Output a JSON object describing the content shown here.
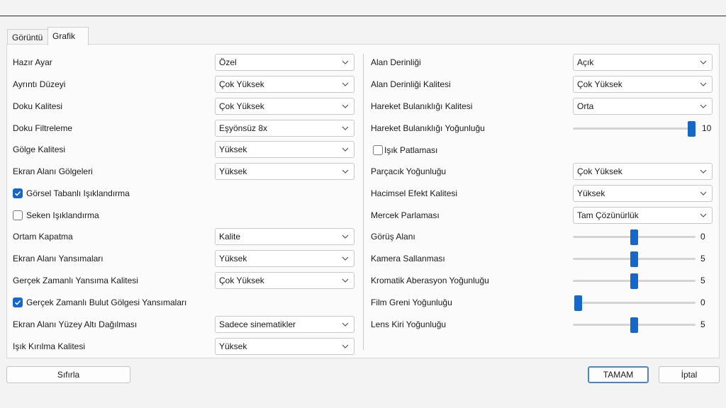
{
  "tabs": {
    "display": "Görüntü",
    "graphics": "Grafik"
  },
  "left": {
    "preset": {
      "label": "Hazır Ayar",
      "value": "Özel"
    },
    "detail": {
      "label": "Ayrıntı Düzeyi",
      "value": "Çok Yüksek"
    },
    "texture": {
      "label": "Doku Kalitesi",
      "value": "Çok Yüksek"
    },
    "filter": {
      "label": "Doku Filtreleme",
      "value": "Eşyönsüz 8x"
    },
    "shadow": {
      "label": "Gölge Kalitesi",
      "value": "Yüksek"
    },
    "ssshadow": {
      "label": "Ekran Alanı Gölgeleri",
      "value": "Yüksek"
    },
    "ibl": {
      "label": "Görsel Tabanlı Işıklandırma",
      "checked": true
    },
    "bounce": {
      "label": "Seken Işıklandırma",
      "checked": false
    },
    "ao": {
      "label": "Ortam Kapatma",
      "value": "Kalite"
    },
    "ssr": {
      "label": "Ekran Alanı Yansımaları",
      "value": "Yüksek"
    },
    "rtr": {
      "label": "Gerçek Zamanlı Yansıma Kalitesi",
      "value": "Çok Yüksek"
    },
    "cloud": {
      "label": "Gerçek Zamanlı Bulut Gölgesi Yansımaları",
      "checked": true
    },
    "sss": {
      "label": "Ekran Alanı Yüzey Altı Dağılması",
      "value": "Sadece sinematikler"
    },
    "refraction": {
      "label": "Işık Kırılma Kalitesi",
      "value": "Yüksek"
    }
  },
  "right": {
    "dof": {
      "label": "Alan Derinliği",
      "value": "Açık"
    },
    "dofq": {
      "label": "Alan Derinliği Kalitesi",
      "value": "Çok Yüksek"
    },
    "mbq": {
      "label": "Hareket Bulanıklığı Kalitesi",
      "value": "Orta"
    },
    "mbi": {
      "label": "Hareket Bulanıklığı Yoğunluğu",
      "value": "10",
      "level": 1.0
    },
    "bloom": {
      "label": "Işık Patlaması",
      "checked": false
    },
    "particle": {
      "label": "Parçacık Yoğunluğu",
      "value": "Çok Yüksek"
    },
    "volumetric": {
      "label": "Hacimsel Efekt Kalitesi",
      "value": "Yüksek"
    },
    "flare": {
      "label": "Mercek Parlaması",
      "value": "Tam Çözünürlük"
    },
    "fov": {
      "label": "Görüş Alanı",
      "value": "0",
      "level": 0.5
    },
    "shake": {
      "label": "Kamera Sallanması",
      "value": "5",
      "level": 0.5
    },
    "chroma": {
      "label": "Kromatik Aberasyon Yoğunluğu",
      "value": "5",
      "level": 0.5
    },
    "grain": {
      "label": "Film Greni Yoğunluğu",
      "value": "0",
      "level": 0.0
    },
    "dirt": {
      "label": "Lens Kiri Yoğunluğu",
      "value": "5",
      "level": 0.5
    }
  },
  "buttons": {
    "reset": "Sıfırla",
    "ok": "TAMAM",
    "cancel": "İptal"
  },
  "colors": {
    "accent": "#1767c7"
  }
}
